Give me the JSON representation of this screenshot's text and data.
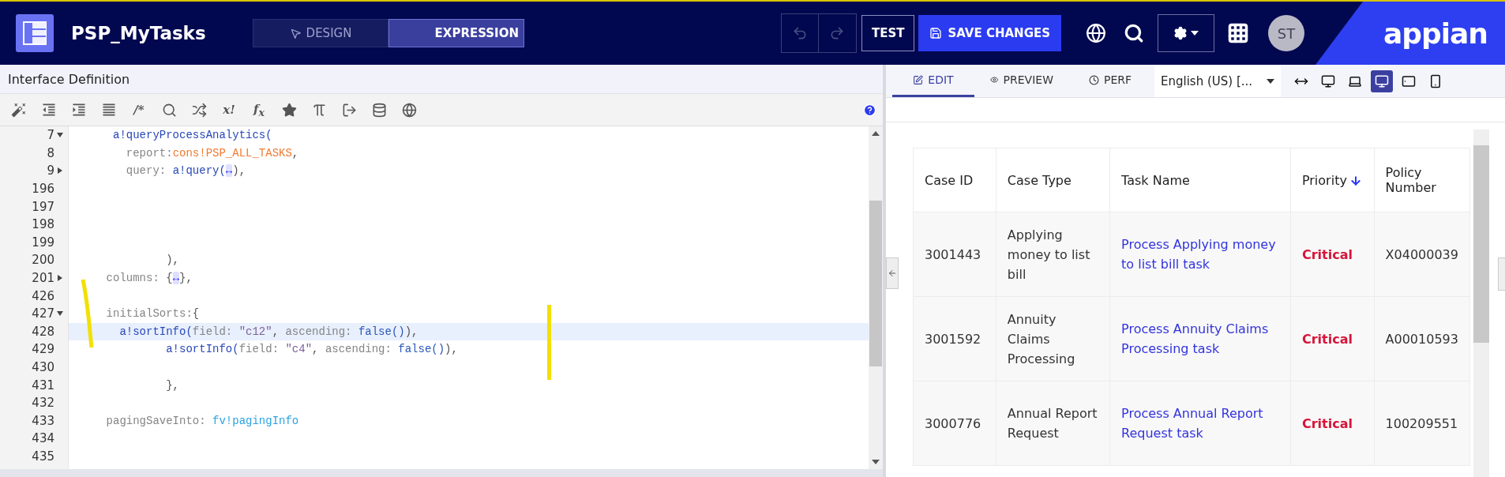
{
  "header": {
    "app_title": "PSP_MyTasks",
    "modes": [
      {
        "label": "DESIGN",
        "kind": "design",
        "selected": false
      },
      {
        "label": "EXPRESSION",
        "kind": "expression",
        "selected": true
      }
    ],
    "test_button": "TEST",
    "save_button": "SAVE CHANGES",
    "avatar": "ST",
    "brand": "appian"
  },
  "editor": {
    "title": "Interface Definition",
    "toolbar_glyphs": [
      "/*",
      "x!",
      "f$_{x}$"
    ],
    "lines": [
      {
        "number": "7",
        "expanded": true,
        "selected": false,
        "tokens": [
          {
            "kind": "fn",
            "text": "     a!queryProcessAnalytics("
          }
        ]
      },
      {
        "number": "8",
        "selected": false,
        "tokens": [
          {
            "kind": "key",
            "text": "       report:"
          },
          {
            "kind": "const",
            "text": "cons!PSP_ALL_TASKS"
          },
          {
            "kind": "punct",
            "text": ","
          }
        ]
      },
      {
        "number": "9",
        "expanded": false,
        "selected": false,
        "tokens": [
          {
            "kind": "key",
            "text": "       query: "
          },
          {
            "kind": "fn",
            "text": "a!query("
          },
          {
            "kind": "chip",
            "text": "↔"
          },
          {
            "kind": "punct",
            "text": "),"
          }
        ]
      },
      {
        "number": "196",
        "selected": false
      },
      {
        "number": "197",
        "selected": false
      },
      {
        "number": "198",
        "selected": false
      },
      {
        "number": "199",
        "selected": false
      },
      {
        "number": "200",
        "selected": false,
        "tokens": [
          {
            "kind": "punct",
            "text": "             ),"
          }
        ]
      },
      {
        "number": "201",
        "expanded": false,
        "selected": false,
        "tokens": [
          {
            "kind": "key",
            "text": "    columns: "
          },
          {
            "kind": "punct",
            "text": "{"
          },
          {
            "kind": "chip",
            "text": "↔"
          },
          {
            "kind": "punct",
            "text": "},"
          }
        ]
      },
      {
        "number": "426",
        "selected": false
      },
      {
        "number": "427",
        "expanded": true,
        "selected": false,
        "tokens": [
          {
            "kind": "key",
            "text": "    initialSorts:"
          },
          {
            "kind": "punct",
            "text": "{"
          }
        ]
      },
      {
        "number": "428",
        "selected": true,
        "tokens": [
          {
            "kind": "fn",
            "text": "      a!sortInfo("
          },
          {
            "kind": "key",
            "text": "field: "
          },
          {
            "kind": "str",
            "text": "\"c12\""
          },
          {
            "kind": "punct",
            "text": ", "
          },
          {
            "kind": "key",
            "text": "ascending: "
          },
          {
            "kind": "bool",
            "text": "false()"
          },
          {
            "kind": "punct",
            "text": "),"
          }
        ]
      },
      {
        "number": "429",
        "selected": false,
        "tokens": [
          {
            "kind": "fn",
            "text": "             a!sortInfo("
          },
          {
            "kind": "key",
            "text": "field: "
          },
          {
            "kind": "str",
            "text": "\"c4\""
          },
          {
            "kind": "punct",
            "text": ", "
          },
          {
            "kind": "key",
            "text": "ascending: "
          },
          {
            "kind": "bool",
            "text": "false()"
          },
          {
            "kind": "punct",
            "text": "),"
          }
        ]
      },
      {
        "number": "430",
        "selected": false
      },
      {
        "number": "431",
        "selected": false,
        "tokens": [
          {
            "kind": "punct",
            "text": "             },"
          }
        ]
      },
      {
        "number": "432",
        "selected": false
      },
      {
        "number": "433",
        "selected": false,
        "tokens": [
          {
            "kind": "key",
            "text": "    pagingSaveInto: "
          },
          {
            "kind": "var",
            "text": "fv!pagingInfo"
          }
        ]
      },
      {
        "number": "434",
        "selected": false
      },
      {
        "number": "435",
        "selected": false
      }
    ]
  },
  "preview": {
    "tabs": [
      {
        "label": "EDIT",
        "kind": "edit",
        "selected": true
      },
      {
        "label": "PREVIEW",
        "kind": "preview",
        "selected": false
      },
      {
        "label": "PERF",
        "kind": "performance",
        "selected": false
      }
    ],
    "locale": "English (US) [...",
    "devices": [
      {
        "kind": "fit",
        "selected": false
      },
      {
        "kind": "desktop",
        "selected": false
      },
      {
        "kind": "laptop",
        "selected": false
      },
      {
        "kind": "tablet-landscape",
        "selected": true
      },
      {
        "kind": "tablet",
        "selected": false
      },
      {
        "kind": "phone",
        "selected": false
      }
    ],
    "table": {
      "columns": [
        {
          "label": "Case ID",
          "sorted": false
        },
        {
          "label": "Case Type",
          "sorted": false
        },
        {
          "label": "Task Name",
          "sorted": false
        },
        {
          "label": "Priority",
          "sorted": true
        },
        {
          "label": "Policy Number",
          "sorted": false
        }
      ],
      "rows": [
        {
          "case_id": "3001443",
          "case_type": "Applying money to list bill",
          "task_name": "Process Applying money to list bill task",
          "priority": "Critical",
          "policy_number": "X04000039"
        },
        {
          "case_id": "3001592",
          "case_type": "Annuity Claims Processing",
          "task_name": "Process Annuity Claims Processing task",
          "priority": "Critical",
          "policy_number": "A00010593"
        },
        {
          "case_id": "3000776",
          "case_type": "Annual Report Request",
          "task_name": "Process Annual Report Request task",
          "priority": "Critical",
          "policy_number": "100209551"
        }
      ]
    }
  }
}
